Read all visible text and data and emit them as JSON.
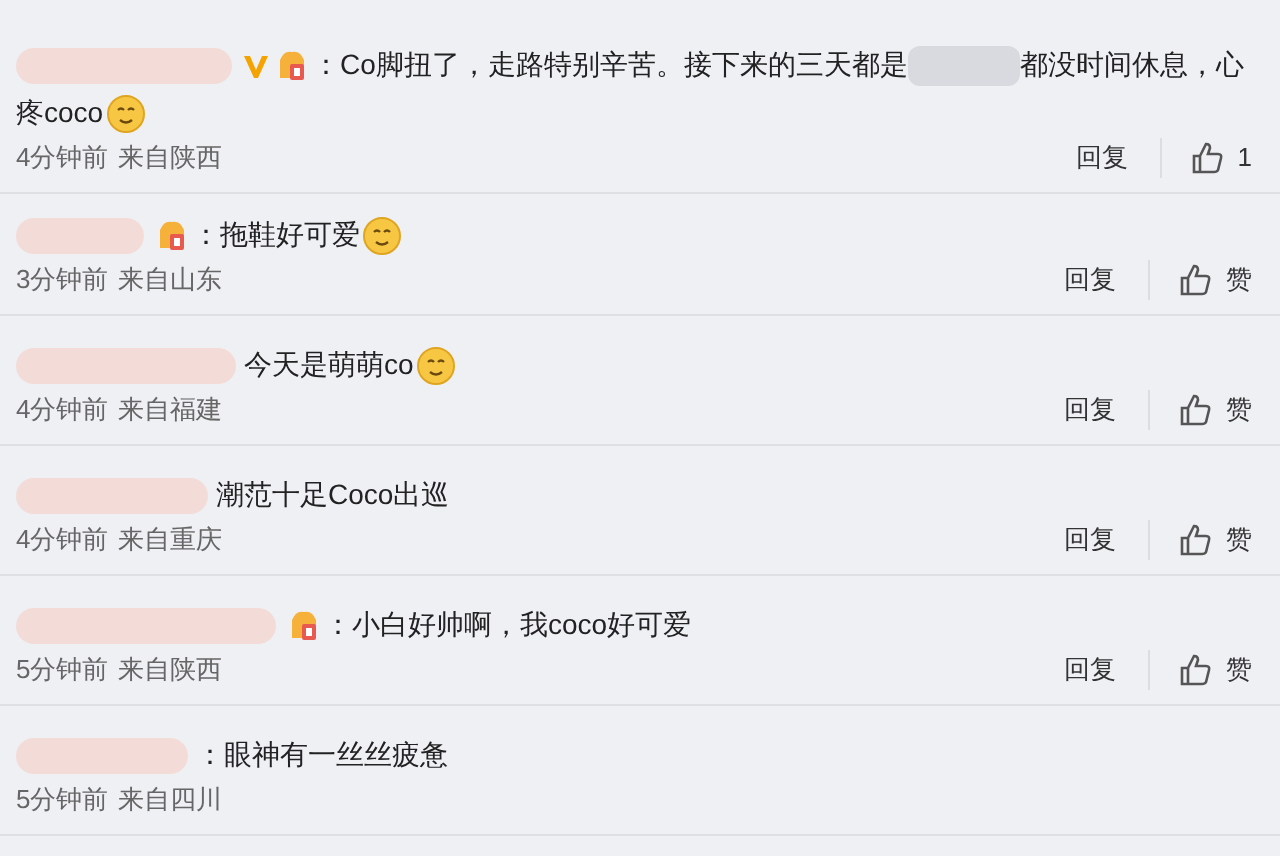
{
  "comments": [
    {
      "segments": [
        {
          "kind": "vip-badge"
        },
        {
          "kind": "fan-badge"
        },
        {
          "kind": "text",
          "text": "：Co脚扭了，走路特别辛苦。接下来的三天都是"
        },
        {
          "kind": "blur"
        },
        {
          "kind": "text",
          "text": "都没时间休息，心"
        },
        {
          "kind": "text",
          "text": "疼coco"
        },
        {
          "kind": "emoji"
        }
      ],
      "time": "4分钟前",
      "location": "来自陕西",
      "reply": "回复",
      "like": "1"
    },
    {
      "segments": [
        {
          "kind": "fan-badge"
        },
        {
          "kind": "text",
          "text": "：拖鞋好可爱"
        },
        {
          "kind": "emoji"
        }
      ],
      "time": "3分钟前",
      "location": "来自山东",
      "reply": "回复",
      "like": "赞"
    },
    {
      "segments": [
        {
          "kind": "text",
          "text": "今天是萌萌co"
        },
        {
          "kind": "emoji"
        }
      ],
      "time": "4分钟前",
      "location": "来自福建",
      "reply": "回复",
      "like": "赞"
    },
    {
      "segments": [
        {
          "kind": "text",
          "text": "潮范十足Coco出巡"
        }
      ],
      "time": "4分钟前",
      "location": "来自重庆",
      "reply": "回复",
      "like": "赞"
    },
    {
      "segments": [
        {
          "kind": "fan-badge"
        },
        {
          "kind": "text",
          "text": "：小白好帅啊，我coco好可爱"
        }
      ],
      "time": "5分钟前",
      "location": "来自陕西",
      "reply": "回复",
      "like": "赞"
    },
    {
      "segments": [
        {
          "kind": "text",
          "text": "：眼神有一丝丝疲惫"
        }
      ],
      "time": "5分钟前",
      "location": "来自四川"
    }
  ]
}
